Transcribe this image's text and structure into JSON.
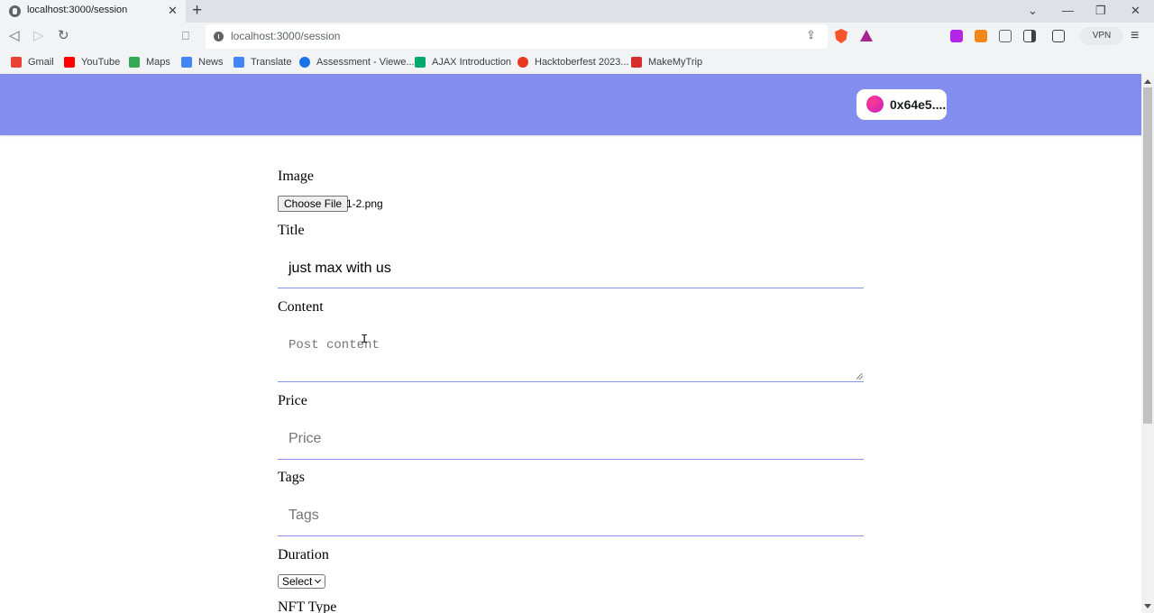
{
  "browser": {
    "tab_title": "localhost:3000/session",
    "tab_close": "✕",
    "new_tab": "+",
    "url": "localhost:3000/session",
    "vpn_label": "VPN",
    "window_controls": {
      "minimize": "—",
      "maximize": "❐",
      "close": "✕"
    },
    "nav": {
      "back": "◁",
      "forward": "▷",
      "reload": "↻",
      "bookmark": "⎕",
      "share": "⇪",
      "menu": "≡",
      "tabsearch": "⌄"
    },
    "bookmarks": [
      {
        "label": "Gmail",
        "color": "#ea4335"
      },
      {
        "label": "YouTube",
        "color": "#ff0000"
      },
      {
        "label": "Maps",
        "color": "#34a853"
      },
      {
        "label": "News",
        "color": "#4285f4"
      },
      {
        "label": "Translate",
        "color": "#4285f4"
      },
      {
        "label": "Assessment - Viewe...",
        "color": "#1a73e8"
      },
      {
        "label": "AJAX Introduction",
        "color": "#04aa6d"
      },
      {
        "label": "Hacktoberfest 2023...",
        "color": "#e8381f"
      },
      {
        "label": "MakeMyTrip",
        "color": "#d32f2f"
      }
    ]
  },
  "header": {
    "background": "#838ded",
    "wallet_address": "0x64e5...."
  },
  "form": {
    "image_label": "Image",
    "choose_file_label": "Choose File",
    "file_name": "1-2.png",
    "title_label": "Title",
    "title_value": "just max with us",
    "content_label": "Content",
    "content_placeholder": "Post content",
    "price_label": "Price",
    "price_placeholder": "Price",
    "tags_label": "Tags",
    "tags_placeholder": "Tags",
    "duration_label": "Duration",
    "duration_selected": "Select",
    "nft_type_label": "NFT Type"
  }
}
